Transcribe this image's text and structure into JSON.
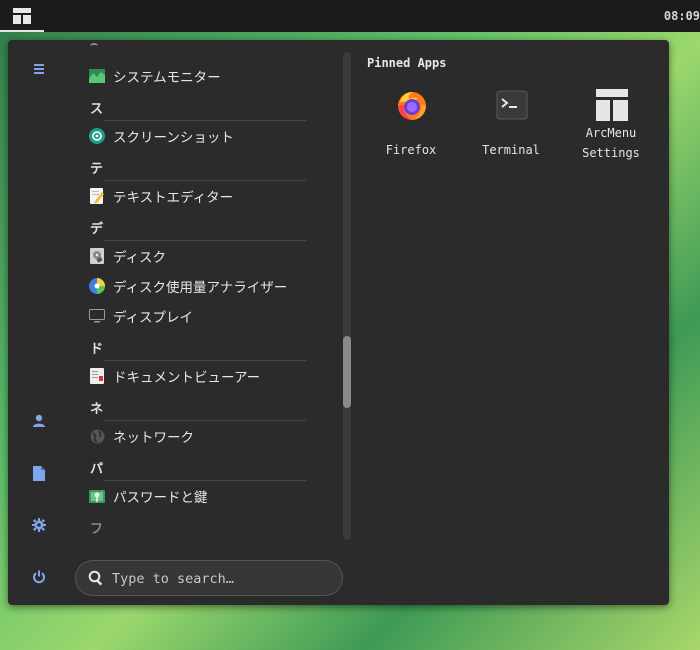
{
  "topbar": {
    "clock": "08:09"
  },
  "app_list": {
    "items": [
      {
        "type": "app",
        "label": "システムモニター",
        "icon": "system-monitor-icon"
      },
      {
        "type": "category",
        "label": "ス"
      },
      {
        "type": "app",
        "label": "スクリーンショット",
        "icon": "screenshot-icon"
      },
      {
        "type": "category",
        "label": "テ"
      },
      {
        "type": "app",
        "label": "テキストエディター",
        "icon": "text-editor-icon"
      },
      {
        "type": "category",
        "label": "デ"
      },
      {
        "type": "app",
        "label": "ディスク",
        "icon": "disks-icon"
      },
      {
        "type": "app",
        "label": "ディスク使用量アナライザー",
        "icon": "disk-usage-analyzer-icon"
      },
      {
        "type": "app",
        "label": "ディスプレイ",
        "icon": "display-icon"
      },
      {
        "type": "category",
        "label": "ド"
      },
      {
        "type": "app",
        "label": "ドキュメントビューアー",
        "icon": "document-viewer-icon"
      },
      {
        "type": "category",
        "label": "ネ"
      },
      {
        "type": "app",
        "label": "ネットワーク",
        "icon": "network-icon"
      },
      {
        "type": "category",
        "label": "パ"
      },
      {
        "type": "app",
        "label": "パスワードと鍵",
        "icon": "passwords-keys-icon"
      },
      {
        "type": "category",
        "label": "フ"
      }
    ]
  },
  "pinned": {
    "title": "Pinned Apps",
    "apps": [
      {
        "label": "Firefox",
        "icon": "firefox-icon"
      },
      {
        "label": "Terminal",
        "icon": "terminal-icon"
      },
      {
        "label_line1": "ArcMenu",
        "label_line2": "Settings",
        "icon": "arcmenu-settings-icon"
      }
    ]
  },
  "sidebar": {
    "buttons": [
      "menu-icon",
      "user-icon",
      "document-icon",
      "settings-icon",
      "power-icon"
    ]
  },
  "search": {
    "placeholder": "Type to search…",
    "value": ""
  },
  "colors": {
    "accent": "#7fa6ea",
    "menu_bg": "#2b2b2b",
    "topbar_bg": "#1b1b1b"
  }
}
